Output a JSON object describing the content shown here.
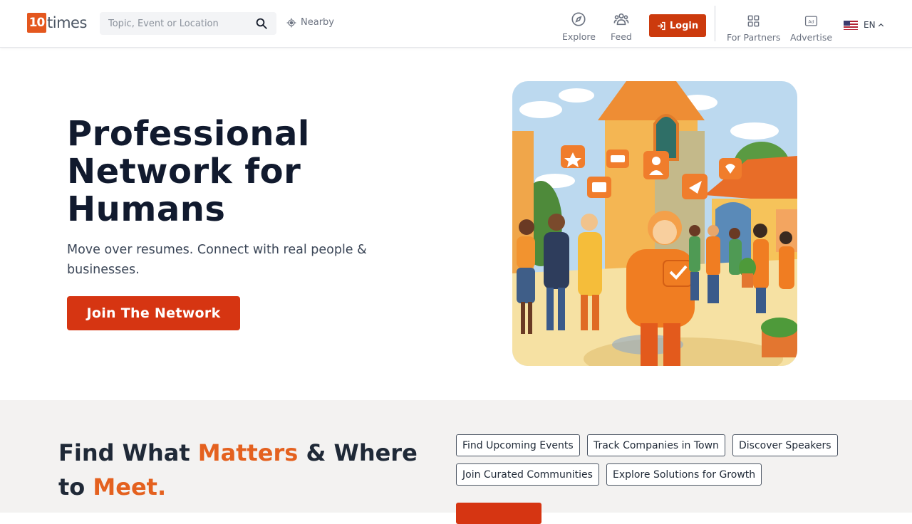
{
  "header": {
    "logo_number": "10",
    "logo_text": "times",
    "search_placeholder": "Topic, Event or Location",
    "nearby_label": "Nearby",
    "nav": {
      "explore": "Explore",
      "feed": "Feed",
      "login": "Login",
      "partners": "For Partners",
      "advertise": "Advertise"
    },
    "language": "EN"
  },
  "hero": {
    "title_line1": "Professional",
    "title_line2": "Network for",
    "title_line3": "Humans",
    "subtitle": "Move over resumes. Connect with real people & businesses.",
    "cta": "Join The Network",
    "illustration_icon": "people-networking-illustration"
  },
  "find": {
    "title_part1": "Find What ",
    "title_highlight1": "Matters",
    "title_part2": " & Where to ",
    "title_highlight2": "Meet.",
    "chips": [
      "Find Upcoming Events",
      "Track Companies in Town",
      "Discover Speakers",
      "Join Curated Communities",
      "Explore Solutions for Growth"
    ]
  },
  "colors": {
    "brand": "#e4571e",
    "cta": "#d63512",
    "highlight": "#e4611f",
    "title": "#111a2e"
  }
}
